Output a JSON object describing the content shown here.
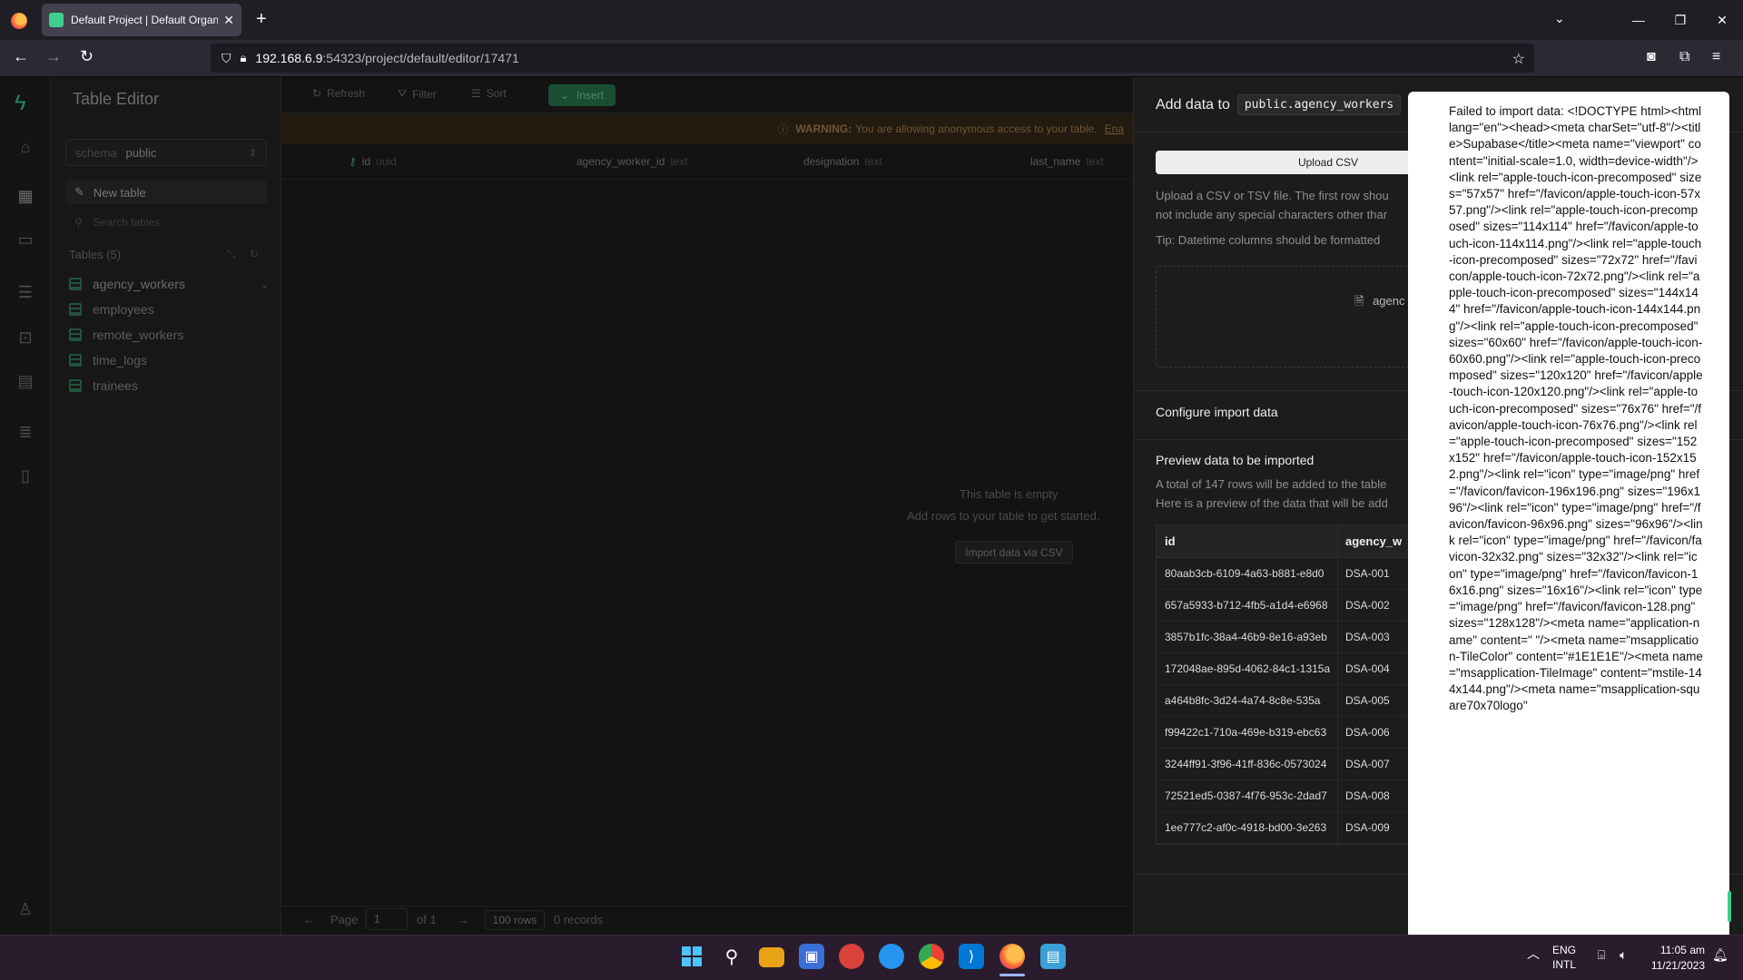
{
  "browser": {
    "tab_title": "Default Project | Default Organi",
    "url_host": "192.168.6.9",
    "url_rest": ":54323/project/default/editor/17471",
    "new_tab": "+",
    "close_tab": "✕"
  },
  "sidebar": {
    "title": "Table Editor",
    "schema_label": "schema",
    "schema_value": "public",
    "new_table": "New table",
    "search_placeholder": "Search tables",
    "tables_heading": "Tables (5)",
    "tables": [
      {
        "name": "agency_workers"
      },
      {
        "name": "employees"
      },
      {
        "name": "remote_workers"
      },
      {
        "name": "time_logs"
      },
      {
        "name": "trainees"
      }
    ]
  },
  "toolbar": {
    "refresh": "Refresh",
    "filter": "Filter",
    "sort": "Sort",
    "insert": "Insert"
  },
  "warning": {
    "label": "WARNING:",
    "text": "You are allowing anonymous access to your table.",
    "link": "Ena"
  },
  "grid": {
    "columns": [
      {
        "name": "id",
        "type": "uuid"
      },
      {
        "name": "agency_worker_id",
        "type": "text"
      },
      {
        "name": "designation",
        "type": "text"
      },
      {
        "name": "last_name",
        "type": "text"
      }
    ],
    "empty_title": "This table is empty",
    "empty_sub": "Add rows to your table to get started.",
    "import_button": "Import data via CSV"
  },
  "footer": {
    "page_label": "Page",
    "page_value": "1",
    "of_label": "of 1",
    "rows_select": "100 rows",
    "records": "0 records"
  },
  "panel": {
    "title": "Add data to",
    "table_name": "public.agency_workers",
    "upload_button": "Upload CSV",
    "desc_line1": "Upload a CSV or TSV file. The first row shou",
    "desc_line2": "not include any special characters other thar",
    "tip": "Tip: Datetime columns should be formatted",
    "file_name": "agenc",
    "configure_title": "Configure import data",
    "preview_title": "Preview data to be imported",
    "preview_line1": "A total of 147 rows will be added to the table",
    "preview_line2": "Here is a preview of the data that will be add",
    "preview_columns": [
      "id",
      "agency_w"
    ],
    "preview_rows": [
      [
        "80aab3cb-6109-4a63-b881-e8d0",
        "DSA-001"
      ],
      [
        "657a5933-b712-4fb5-a1d4-e6968",
        "DSA-002"
      ],
      [
        "3857b1fc-38a4-46b9-8e16-a93eb",
        "DSA-003"
      ],
      [
        "172048ae-895d-4062-84c1-1315a",
        "DSA-004"
      ],
      [
        "a464b8fc-3d24-4a74-8c8e-535a",
        "DSA-005"
      ],
      [
        "f99422c1-710a-469e-b319-ebc63",
        "DSA-006"
      ],
      [
        "3244ff91-3f96-41ff-836c-0573024",
        "DSA-007"
      ],
      [
        "72521ed5-0387-4f76-953c-2dad7",
        "DSA-008"
      ],
      [
        "1ee777c2-af0c-4918-bd00-3e263",
        "DSA-009"
      ]
    ]
  },
  "toast": {
    "message": "Failed to import data: <!DOCTYPE html><html lang=\"en\"><head><meta charSet=\"utf-8\"/><title>Supabase</title><meta name=\"viewport\" content=\"initial-scale=1.0, width=device-width\"/><link rel=\"apple-touch-icon-precomposed\" sizes=\"57x57\" href=\"/favicon/apple-touch-icon-57x57.png\"/><link rel=\"apple-touch-icon-precomposed\" sizes=\"114x114\" href=\"/favicon/apple-touch-icon-114x114.png\"/><link rel=\"apple-touch-icon-precomposed\" sizes=\"72x72\" href=\"/favicon/apple-touch-icon-72x72.png\"/><link rel=\"apple-touch-icon-precomposed\" sizes=\"144x144\" href=\"/favicon/apple-touch-icon-144x144.png\"/><link rel=\"apple-touch-icon-precomposed\" sizes=\"60x60\" href=\"/favicon/apple-touch-icon-60x60.png\"/><link rel=\"apple-touch-icon-precomposed\" sizes=\"120x120\" href=\"/favicon/apple-touch-icon-120x120.png\"/><link rel=\"apple-touch-icon-precomposed\" sizes=\"76x76\" href=\"/favicon/apple-touch-icon-76x76.png\"/><link rel=\"apple-touch-icon-precomposed\" sizes=\"152x152\" href=\"/favicon/apple-touch-icon-152x152.png\"/><link rel=\"icon\" type=\"image/png\" href=\"/favicon/favicon-196x196.png\" sizes=\"196x196\"/><link rel=\"icon\" type=\"image/png\" href=\"/favicon/favicon-96x96.png\" sizes=\"96x96\"/><link rel=\"icon\" type=\"image/png\" href=\"/favicon/favicon-32x32.png\" sizes=\"32x32\"/><link rel=\"icon\" type=\"image/png\" href=\"/favicon/favicon-16x16.png\" sizes=\"16x16\"/><link rel=\"icon\" type=\"image/png\" href=\"/favicon/favicon-128.png\" sizes=\"128x128\"/><meta name=\"application-name\" content=\" \"/><meta name=\"msapplication-TileColor\" content=\"#1E1E1E\"/><meta name=\"msapplication-TileImage\" content=\"mstile-144x144.png\"/><meta name=\"msapplication-square70x70logo\""
  },
  "taskbar": {
    "lang_line1": "ENG",
    "lang_line2": "INTL",
    "time": "11:05 am",
    "date": "11/21/2023"
  },
  "colors": {
    "accent": "#3ecf8e",
    "taskbar": "#2a1c2c",
    "toast_bg": "#ffffff"
  }
}
